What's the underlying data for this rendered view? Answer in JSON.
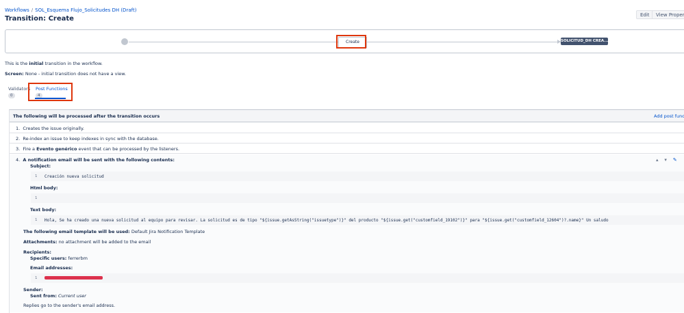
{
  "breadcrumb": {
    "root": "Workflows",
    "separator": "/",
    "workflow": "SOL_Esquema Flujo_Solicitudes DH (Draft)"
  },
  "page_title": "Transition: Create",
  "header_buttons": {
    "edit": "Edit",
    "view_properties": "View Propertie"
  },
  "diagram": {
    "transition": "Create",
    "target_status": "SOLICITUD_DH CREA..."
  },
  "info": {
    "line1_pre": "This is the ",
    "line1_bold": "initial",
    "line1_post": " transition in the workflow.",
    "screen_label": "Screen:",
    "screen_value": " None - initial transition does not have a view."
  },
  "tabs": [
    {
      "label": "Validators",
      "count": "0"
    },
    {
      "label": "Post Functions",
      "count": "4"
    }
  ],
  "post_functions": {
    "header": "The following will be processed after the transition occurs",
    "add_link": "Add post funct",
    "items": [
      {
        "num": "1.",
        "text": "Creates the issue originally."
      },
      {
        "num": "2.",
        "text": "Re-index an issue to keep indexes in sync with the database."
      },
      {
        "num": "3.",
        "pre": "Fire a ",
        "bold": "Evento genérico",
        "post": " event that can be processed by the listeners."
      }
    ],
    "item4": {
      "num": "4.",
      "title": "A notification email will be sent with the following contents:",
      "subject_label": "Subject:",
      "subject_line": "1",
      "subject_value": "Creación nueva solicitud",
      "html_label": "Html body:",
      "html_line": "1",
      "text_label": "Text body:",
      "text_line": "1",
      "text_value": "Hola, Se ha creado una nueva solicitud al equipo para revisar. La solicitud es de tipo \"${issue.getAsString(\"issuetype\")}\" del producto \"${issue.get(\"customfield_19102\")}\" para \"${issue.get(\"customfield_12604\")?.name}\" Un saludo",
      "template_label": "The following email template will be used:",
      "template_value": " Default Jira Notification Template",
      "attachments_label": "Attachments:",
      "attachments_value": " no attachment will be added to the email",
      "recipients_label": "Recipients:",
      "specific_users_label": "Specific users:",
      "specific_users_value": " ferrerbm",
      "email_label": "Email addresses:",
      "email_line": "1",
      "sender_label": "Sender:",
      "sent_from_label": "Sent from:",
      "sent_from_value": "Current user",
      "replies": "Replies go to the sender's email address."
    }
  },
  "colors": {
    "accent": "#0052cc",
    "highlight": "#de350b",
    "status_bg": "#42526e",
    "redaction": "#d91c3a"
  },
  "icons": [
    "arrow-up-icon",
    "arrow-down-icon",
    "pencil-icon"
  ]
}
